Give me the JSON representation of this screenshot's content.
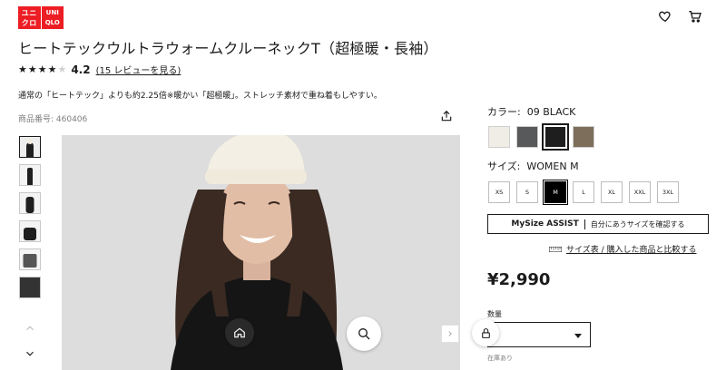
{
  "header": {
    "logo_katakana_top": "ユニ",
    "logo_katakana_bottom": "クロ",
    "logo_latin_top": "UNI",
    "logo_latin_bottom": "QLO",
    "icons": [
      "heart-icon",
      "cart-icon"
    ]
  },
  "product": {
    "title": "ヒートテックウルトラウォームクルーネックT（超極暖・長袖）",
    "rating_stars": 4,
    "rating_max": 5,
    "rating_value": "4.2",
    "review_link": "(15 レビューを見る)",
    "description": "通常の「ヒートテック」よりも約2.25倍※暖かい「超極暖」。ストレッチ素材で重ね着もしやすい。",
    "product_number": "商品番号: 460406"
  },
  "gallery": {
    "thumbnails": 6,
    "active_index": 0,
    "icons": [
      "share-icon",
      "home-icon",
      "zoom-icon",
      "chevron-up-icon",
      "chevron-down-icon",
      "chevron-right-icon"
    ]
  },
  "options": {
    "color_label": "カラー:",
    "color_value": "09 BLACK",
    "colors": [
      {
        "name": "off-white",
        "hex": "#efede6"
      },
      {
        "name": "dark-gray",
        "hex": "#58595b"
      },
      {
        "name": "black",
        "hex": "#1e1e1e",
        "selected": true
      },
      {
        "name": "brown",
        "hex": "#7d6e5c"
      }
    ],
    "size_label": "サイズ:",
    "size_value": "WOMEN M",
    "sizes": [
      "XS",
      "S",
      "M",
      "L",
      "XL",
      "XXL",
      "3XL"
    ],
    "selected_size": "M"
  },
  "mysize": {
    "brand": "MySize ASSIST",
    "text": "自分にあうサイズを確認する"
  },
  "size_chart_link": "サイズ表 / 購入した商品と比較する",
  "price": "¥2,990",
  "quantity": {
    "label": "数量",
    "value": ""
  },
  "stock_status": "在庫あり"
}
